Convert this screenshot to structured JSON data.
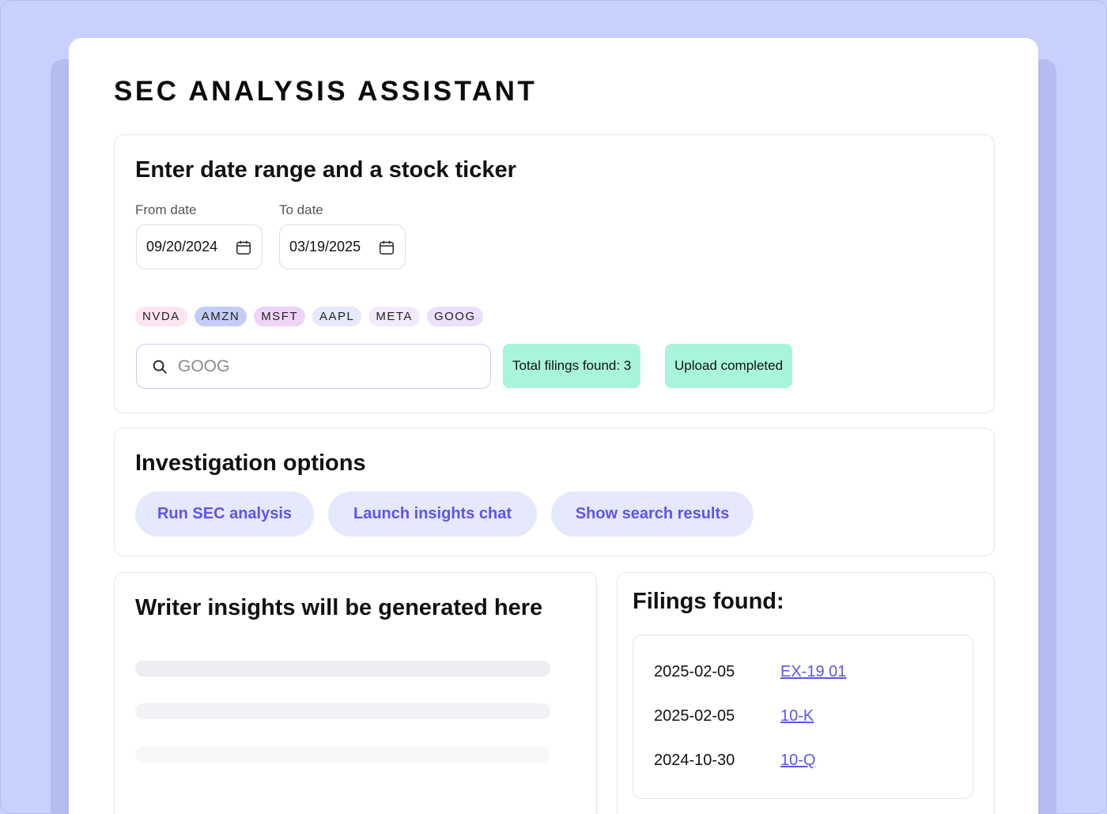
{
  "app": {
    "title": "SEC ANALYSIS ASSISTANT"
  },
  "date_panel": {
    "title": "Enter date range and a stock ticker",
    "from_label": "From date",
    "from_value": "09/20/2024",
    "to_label": "To date",
    "to_value": "03/19/2025"
  },
  "tickers": [
    {
      "label": "NVDA",
      "color": "#fde4f1"
    },
    {
      "label": "AMZN",
      "color": "#c4cdf8"
    },
    {
      "label": "MSFT",
      "color": "#f0d4f8"
    },
    {
      "label": "AAPL",
      "color": "#e6e8fb"
    },
    {
      "label": "META",
      "color": "#f2e9fb"
    },
    {
      "label": "GOOG",
      "color": "#ebdffb"
    }
  ],
  "search": {
    "placeholder": "GOOG"
  },
  "status": {
    "filings_found": "Total filings found: 3",
    "upload": "Upload completed",
    "badge_color": "#a8f5d9"
  },
  "options": {
    "title": "Investigation options",
    "buttons": [
      "Run SEC analysis",
      "Launch insights chat",
      "Show search results"
    ],
    "button_color": "#e6e8fd",
    "button_text_color": "#5b56ea"
  },
  "insights": {
    "title": "Writer insights will be generated here"
  },
  "filings": {
    "title": "Filings found:",
    "rows": [
      {
        "date": "2025-02-05",
        "form": "EX-19 01"
      },
      {
        "date": "2025-02-05",
        "form": "10-K"
      },
      {
        "date": "2024-10-30",
        "form": "10-Q"
      }
    ]
  }
}
